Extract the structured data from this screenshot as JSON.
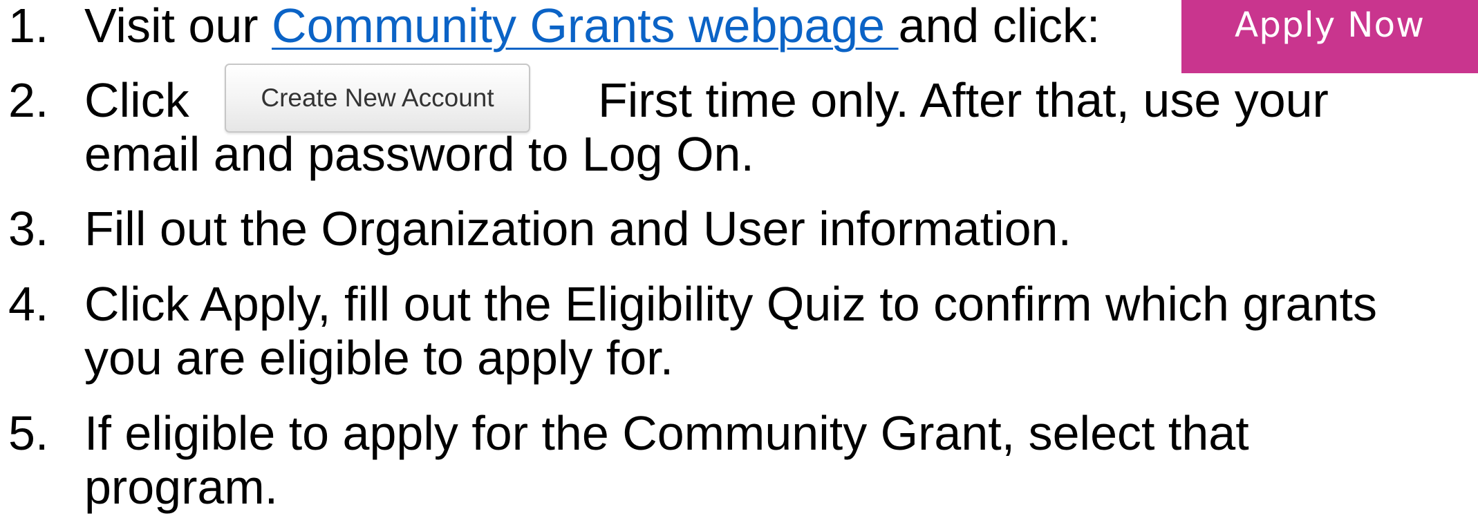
{
  "apply_button": {
    "label": "Apply Now",
    "color": "#c9358e"
  },
  "create_account_button": {
    "label": "Create New Account"
  },
  "link_color": "#0b63c6",
  "steps": [
    {
      "number": "1.",
      "before": "Visit our ",
      "link": "Community Grants webpage ",
      "after": "and click:"
    },
    {
      "number": "2.",
      "before": "Click",
      "after": "First time only. After that, use your",
      "line2": "email and password to Log On."
    },
    {
      "number": "3.",
      "text": "Fill out the Organization and User information."
    },
    {
      "number": "4.",
      "line1": "Click Apply, fill out the Eligibility Quiz to confirm which grants",
      "line2": "you are eligible to apply for."
    },
    {
      "number": "5.",
      "line1": "If eligible to apply for the Community Grant, select that",
      "line2": "program."
    }
  ]
}
